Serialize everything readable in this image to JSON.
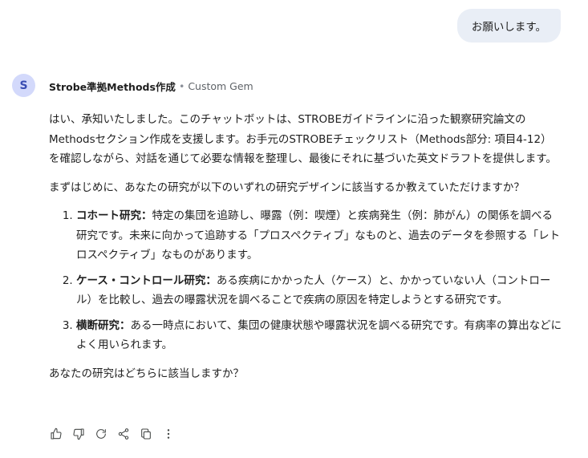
{
  "user_message": "お願いします。",
  "gem": {
    "avatar_letter": "S",
    "name": "Strobe準拠Methods作成",
    "separator": "•",
    "label": "Custom Gem"
  },
  "response": {
    "intro": "はい、承知いたしました。このチャットボットは、STROBEガイドラインに沿った観察研究論文のMethodsセクション作成を支援します。お手元のSTROBEチェックリスト（Methods部分: 項目4-12）を確認しながら、対話を通じて必要な情報を整理し、最後にそれに基づいた英文ドラフトを提供します。",
    "question": "まずはじめに、あなたの研究が以下のいずれの研究デザインに該当するか教えていただけますか？",
    "designs": [
      {
        "title": "コホート研究",
        "sep": "：",
        "desc": "特定の集団を追跡し、曝露（例：喫煙）と疾病発生（例：肺がん）の関係を調べる研究です。未来に向かって追跡する「プロスペクティブ」なものと、過去のデータを参照する「レトロスペクティブ」なものがあります。"
      },
      {
        "title": "ケース・コントロール研究",
        "sep": "：",
        "desc": "ある疾病にかかった人（ケース）と、かかっていない人（コントロール）を比較し、過去の曝露状況を調べることで疾病の原因を特定しようとする研究です。"
      },
      {
        "title": "横断研究",
        "sep": "：",
        "desc": "ある一時点において、集団の健康状態や曝露状況を調べる研究です。有病率の算出などによく用いられます。"
      }
    ],
    "closing": "あなたの研究はどちらに該当しますか？"
  },
  "actions": [
    {
      "icon": "thumbs-up-icon"
    },
    {
      "icon": "thumbs-down-icon"
    },
    {
      "icon": "regenerate-icon"
    },
    {
      "icon": "share-icon"
    },
    {
      "icon": "copy-icon"
    },
    {
      "icon": "more-vert-icon"
    }
  ],
  "colors": {
    "user_bubble": "#e9eef6",
    "avatar_bg": "#d3d9fb",
    "avatar_fg": "#3a4db3",
    "text": "#1f1f1f",
    "muted": "#5f6368"
  }
}
